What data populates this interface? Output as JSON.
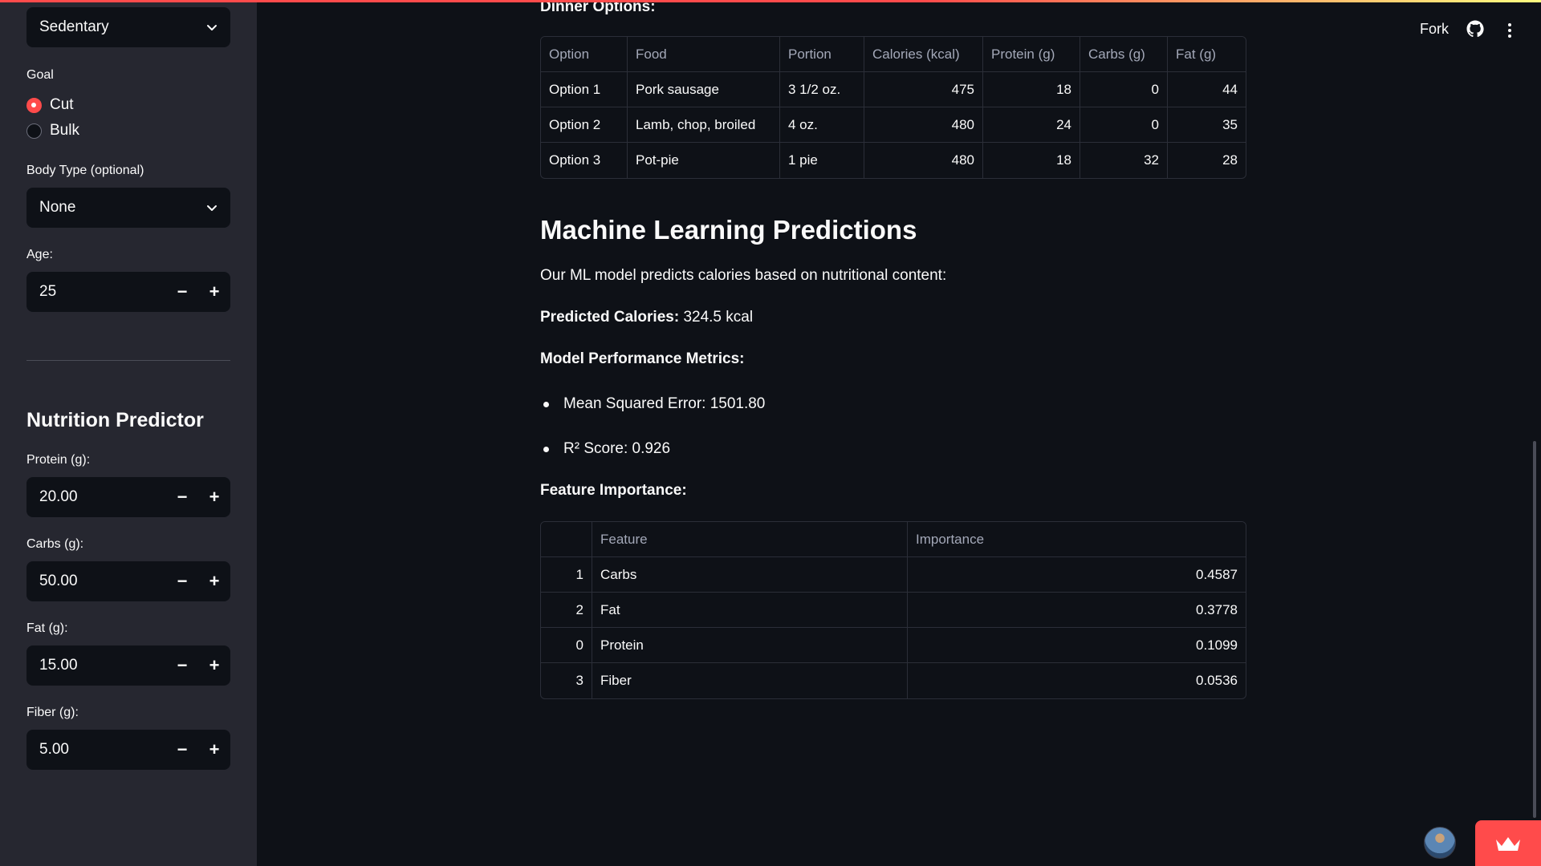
{
  "sidebar": {
    "activity_select": "Sedentary",
    "goal_label": "Goal",
    "goal_options": [
      "Cut",
      "Bulk"
    ],
    "goal_selected": "Cut",
    "body_type_label": "Body Type (optional)",
    "body_type_select": "None",
    "age_label": "Age:",
    "age_value": "25",
    "predictor_heading": "Nutrition Predictor",
    "protein_label": "Protein (g):",
    "protein_value": "20.00",
    "carbs_label": "Carbs (g):",
    "carbs_value": "50.00",
    "fat_label": "Fat (g):",
    "fat_value": "15.00",
    "fiber_label": "Fiber (g):",
    "fiber_value": "5.00",
    "minus": "−",
    "plus": "+"
  },
  "toolbar": {
    "fork_label": "Fork",
    "github_icon": "github-icon",
    "menu_icon": "more-vertical-icon"
  },
  "main": {
    "dinner_heading": "Dinner Options:",
    "dinner_table": {
      "headers": [
        "Option",
        "Food",
        "Portion",
        "Calories (kcal)",
        "Protein (g)",
        "Carbs (g)",
        "Fat (g)"
      ],
      "rows": [
        [
          "Option 1",
          "Pork sausage",
          "3 1/2 oz.",
          "475",
          "18",
          "0",
          "44"
        ],
        [
          "Option 2",
          "Lamb, chop, broiled",
          "4 oz.",
          "480",
          "24",
          "0",
          "35"
        ],
        [
          "Option 3",
          "Pot-pie",
          "1 pie",
          "480",
          "18",
          "32",
          "28"
        ]
      ]
    },
    "ml_heading": "Machine Learning Predictions",
    "ml_intro": "Our ML model predicts calories based on nutritional content:",
    "predicted_label": "Predicted Calories:",
    "predicted_value": " 324.5 kcal",
    "metrics_heading": "Model Performance Metrics:",
    "metrics": [
      "Mean Squared Error: 1501.80",
      "R² Score: 0.926"
    ],
    "feature_heading": "Feature Importance:",
    "feature_table": {
      "headers": [
        "",
        "Feature",
        "Importance"
      ],
      "rows": [
        [
          "1",
          "Carbs",
          "0.4587"
        ],
        [
          "2",
          "Fat",
          "0.3778"
        ],
        [
          "0",
          "Protein",
          "0.1099"
        ],
        [
          "3",
          "Fiber",
          "0.0536"
        ]
      ]
    }
  },
  "colors": {
    "accent": "#ff4b4b",
    "background": "#0e1117",
    "sidebar": "#262730"
  }
}
